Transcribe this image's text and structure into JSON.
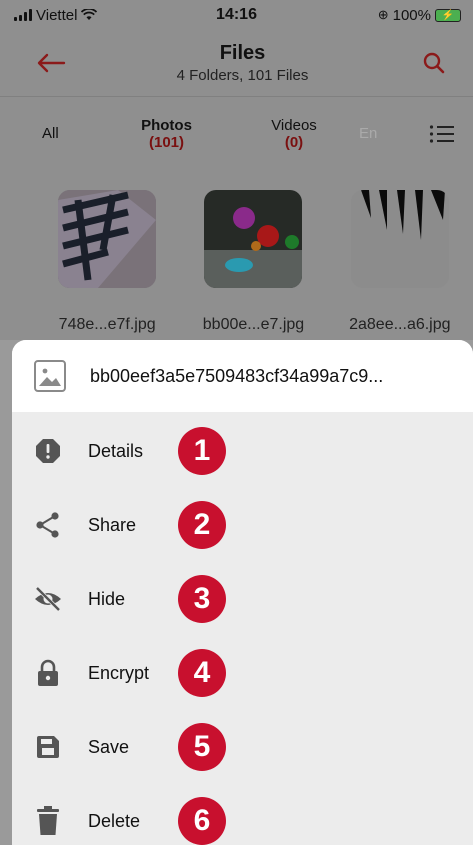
{
  "status_bar": {
    "carrier": "Viettel",
    "time": "14:16",
    "battery": "100%"
  },
  "app_bar": {
    "title": "Files",
    "subtitle": "4 Folders, 101 Files"
  },
  "tabs": [
    {
      "name": "All",
      "count": ""
    },
    {
      "name": "Photos",
      "count": "(101)"
    },
    {
      "name": "Videos",
      "count": "(0)"
    },
    {
      "name": "En",
      "count": ""
    }
  ],
  "thumbnails": [
    {
      "name": "748e...e7f.jpg"
    },
    {
      "name": "bb00e...e7.jpg"
    },
    {
      "name": "2a8ee...a6.jpg"
    }
  ],
  "sheet": {
    "file_name": "bb00eef3a5e7509483cf34a99a7c9...",
    "items": [
      {
        "label": "Details",
        "badge": "1",
        "icon": "alert-octagon-icon"
      },
      {
        "label": "Share",
        "badge": "2",
        "icon": "share-icon"
      },
      {
        "label": "Hide",
        "badge": "3",
        "icon": "eye-off-icon"
      },
      {
        "label": "Encrypt",
        "badge": "4",
        "icon": "lock-icon"
      },
      {
        "label": "Save",
        "badge": "5",
        "icon": "save-icon"
      },
      {
        "label": "Delete",
        "badge": "6",
        "icon": "trash-icon"
      }
    ]
  },
  "colors": {
    "accent": "#8b1a1a",
    "badge": "#c8102e"
  }
}
